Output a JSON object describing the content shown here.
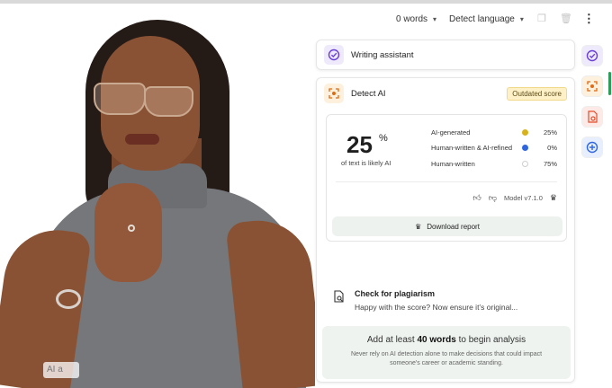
{
  "toolbar": {
    "word_count": "0 words",
    "language": "Detect language",
    "icons": [
      "copy-icon",
      "trash-icon",
      "more-vertical-icon"
    ]
  },
  "photo": {
    "input_placeholder": "AI a"
  },
  "writing_assistant": {
    "title": "Writing assistant",
    "icon": "check-circle-icon"
  },
  "detect_ai": {
    "title": "Detect AI",
    "badge": "Outdated score",
    "score": {
      "value": "25",
      "unit": "%",
      "caption": "of text is likely AI"
    },
    "breakdown": [
      {
        "label": "AI-generated",
        "value": "25%",
        "color": "#d8b21c"
      },
      {
        "label": "Human-written & AI-refined",
        "value": "0%",
        "color": "#2f66e0"
      },
      {
        "label": "Human-written",
        "value": "75%",
        "color": "#ffffff"
      }
    ],
    "model": "Model v7.1.0",
    "download_label": "Download report"
  },
  "plagiarism": {
    "title": "Check for plagiarism",
    "subtitle": "Happy with the score? Now ensure it’s original..."
  },
  "hint": {
    "prefix": "Add at least ",
    "bold": "40 words",
    "suffix": " to begin analysis",
    "note": "Never rely on AI detection alone to make decisions that could impact someone's career or academic standing."
  },
  "rail": {
    "buttons": [
      "check-circle-icon",
      "detect-ai-icon",
      "plagiarism-icon",
      "add-icon"
    ]
  },
  "colors": {
    "accent_green": "#2e9d5a",
    "badge_bg": "#fff1c7",
    "hint_bg": "#eef3ef"
  }
}
